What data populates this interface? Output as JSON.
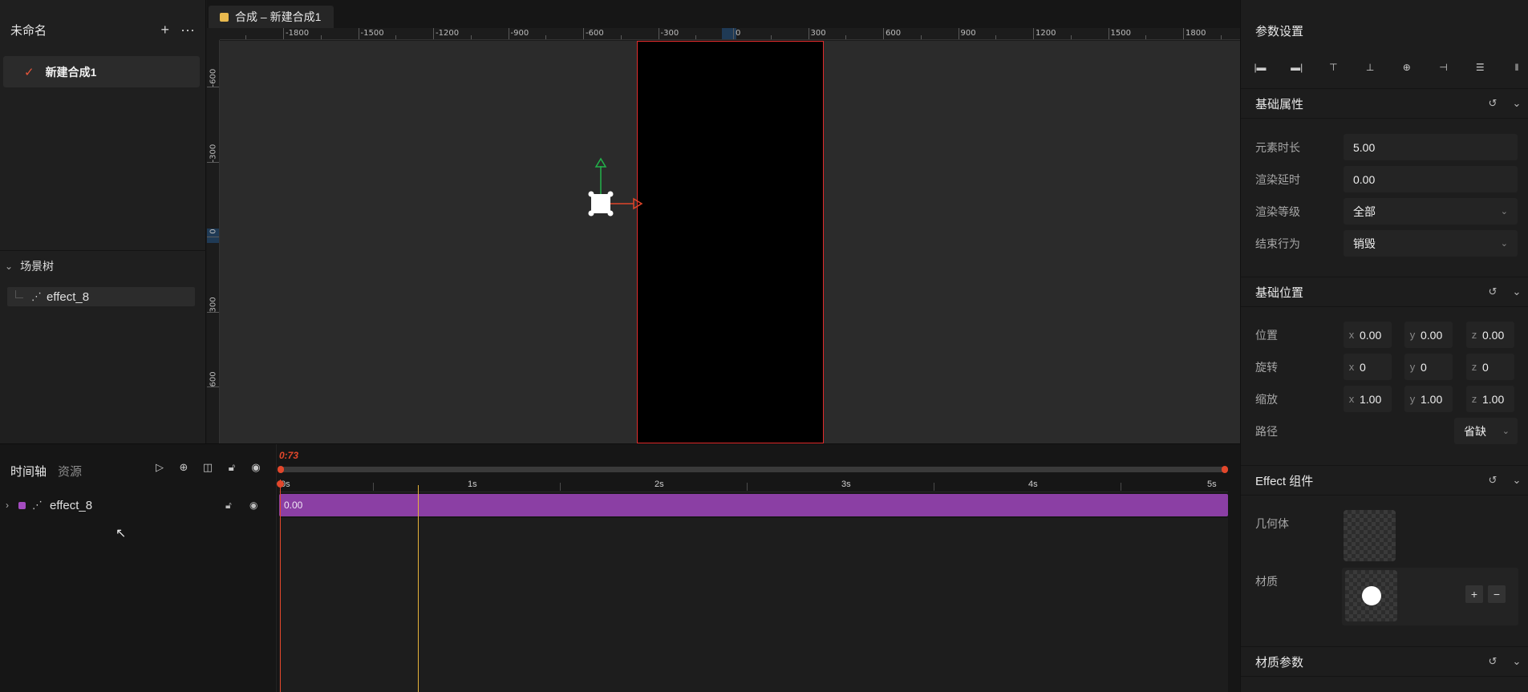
{
  "project": {
    "title": "未命名",
    "add_icon": "plus-icon",
    "more_icon": "more-icon",
    "compositions": [
      {
        "label": "新建合成1",
        "active": true
      }
    ]
  },
  "scene_tree": {
    "title": "场景树",
    "items": [
      {
        "label": "effect_8",
        "icon": "wand-icon"
      }
    ]
  },
  "viewport": {
    "tab_label": "合成 – 新建合成1",
    "tab_color": "#e8b94e",
    "ruler_h": [
      "-1800",
      "-1500",
      "-1200",
      "-900",
      "-600",
      "-300",
      "0",
      "300",
      "600",
      "900",
      "1200",
      "1500",
      "1800"
    ],
    "ruler_v": [
      "-600",
      "-300",
      "0",
      "300",
      "600"
    ],
    "frame_border_color": "#e02b2b"
  },
  "properties": {
    "title": "参数设置",
    "align_icons": [
      "align-left-icon",
      "align-right-icon",
      "align-top-icon",
      "align-bottom-icon",
      "align-center-h-icon",
      "align-center-v-icon",
      "distribute-v-icon",
      "distribute-h-icon"
    ],
    "basic": {
      "title": "基础属性",
      "duration_label": "元素时长",
      "duration": "5.00",
      "delay_label": "渲染延时",
      "delay": "0.00",
      "level_label": "渲染等级",
      "level": "全部",
      "end_label": "结束行为",
      "end": "销毁"
    },
    "transform": {
      "title": "基础位置",
      "position_label": "位置",
      "position": {
        "x": "0.00",
        "y": "0.00",
        "z": "0.00"
      },
      "rotation_label": "旋转",
      "rotation": {
        "x": "0",
        "y": "0",
        "z": "0"
      },
      "scale_label": "缩放",
      "scale": {
        "x": "1.00",
        "y": "1.00",
        "z": "1.00"
      },
      "path_label": "路径",
      "path": "省缺"
    },
    "effect": {
      "title": "Effect 组件",
      "geometry_label": "几何体",
      "material_label": "材质",
      "add": "+",
      "remove": "−"
    },
    "material_params": {
      "title": "材质参数"
    }
  },
  "timeline": {
    "tab_timeline": "时间轴",
    "tab_assets": "资源",
    "current_time": "0:73",
    "seconds": [
      "0s",
      "1s",
      "2s",
      "3s",
      "4s",
      "5s"
    ],
    "layers": [
      {
        "label": "effect_8",
        "color": "#a44cc0",
        "bar_value": "0.00"
      }
    ]
  },
  "axis": {
    "x_label": "x",
    "y_label": "y",
    "z_label": "z"
  }
}
